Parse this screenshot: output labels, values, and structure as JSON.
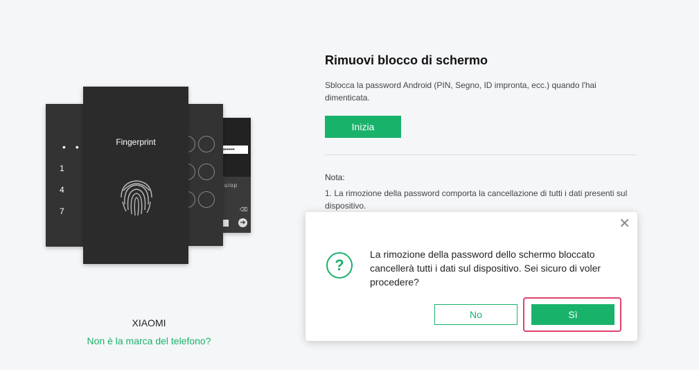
{
  "illustration": {
    "fingerprint_label": "Fingerprint",
    "keypad_numbers": [
      "1",
      "4",
      "7"
    ],
    "keyboard_text": "uiop",
    "password_dots": "••••••"
  },
  "device": {
    "brand": "XIAOMI",
    "not_brand_link": "Non è la marca del telefono?"
  },
  "main": {
    "title": "Rimuovi blocco di schermo",
    "description": "Sblocca la password Android (PIN, Segno, ID impronta, ecc.) quando l'hai dimenticata.",
    "start_button": "Inizia",
    "note_title": "Nota:",
    "note_text": "1. La rimozione della password comporta la cancellazione di tutti i dati presenti sul dispositivo."
  },
  "dialog": {
    "icon": "question-icon",
    "message": "La rimozione della password dello schermo bloccato cancellerà tutti i dati sul dispositivo. Sei sicuro di voler procedere?",
    "no_button": "No",
    "yes_button": "Sì",
    "close_icon": "close-icon"
  },
  "colors": {
    "accent": "#19b26b",
    "highlight": "#e0426c",
    "background": "#f5f6f8"
  }
}
